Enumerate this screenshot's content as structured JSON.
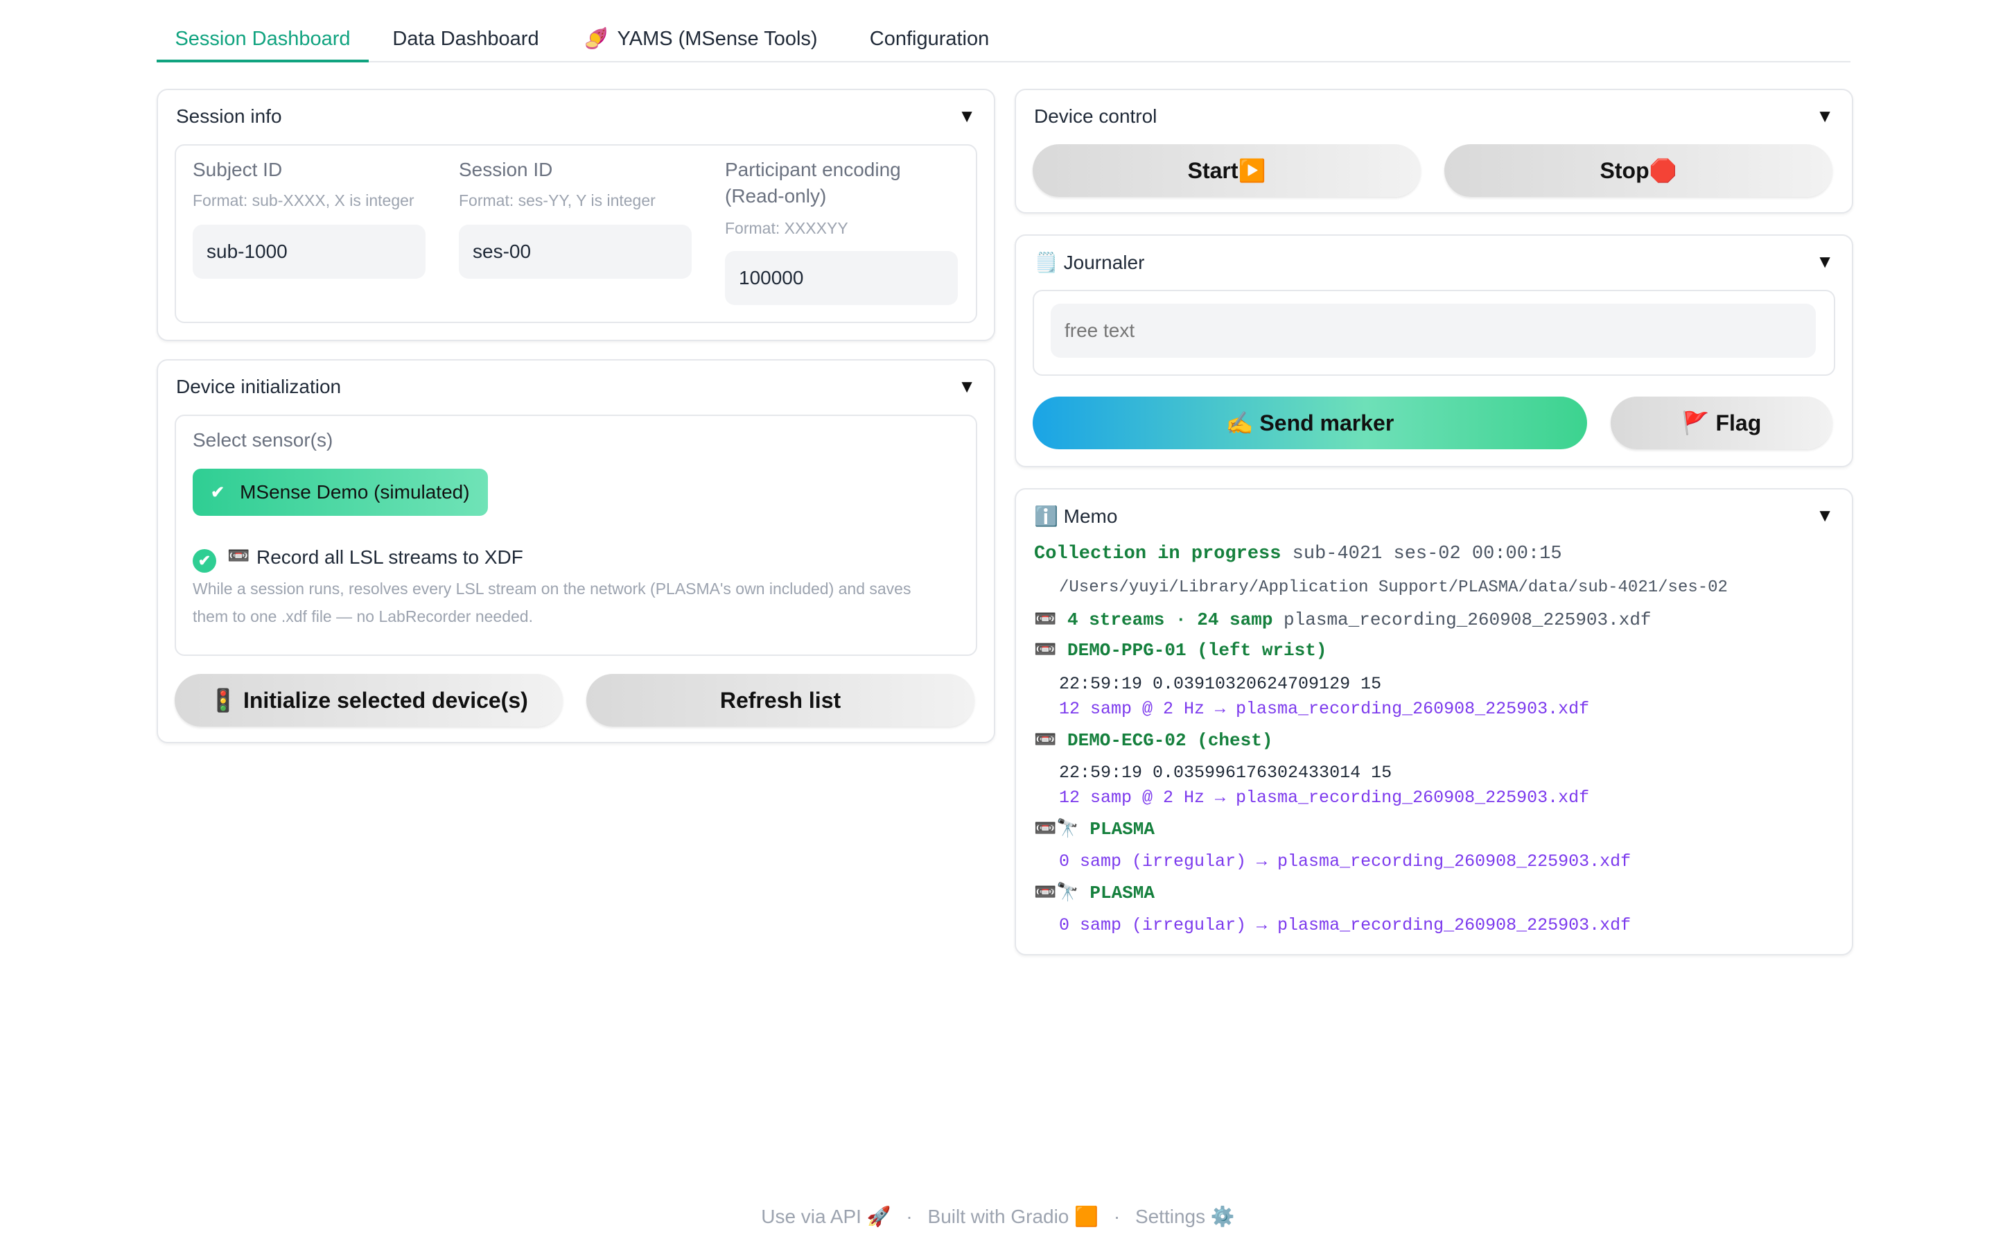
{
  "tabs": [
    {
      "label": "Session Dashboard",
      "icon": ""
    },
    {
      "label": "Data Dashboard",
      "icon": ""
    },
    {
      "label": "YAMS (MSense Tools)",
      "icon": "🍠"
    },
    {
      "label": "Configuration",
      "icon": ""
    }
  ],
  "session_info": {
    "title": "Session info",
    "toggle": "▼",
    "subject": {
      "label": "Subject ID",
      "hint": "Format: sub-XXXX, X is integer",
      "value": "sub-1000"
    },
    "session": {
      "label": "Session ID",
      "hint": "Format: ses-YY, Y is integer",
      "value": "ses-00"
    },
    "encoding": {
      "label_line1": "Participant encoding",
      "label_line2": "(Read-only)",
      "hint": "Format: XXXXYY",
      "value": "100000"
    }
  },
  "device_init": {
    "title": "Device initialization",
    "toggle": "▼",
    "select_label": "Select sensor(s)",
    "sensor_chip": "MSense Demo (simulated)",
    "check_glyph": "✔",
    "record_icon": "📼",
    "record_label": "Record all LSL streams to XDF",
    "record_hint_line1": "While a session runs, resolves every LSL stream on the network (PLASMA's own included) and saves",
    "record_hint_line2": "them to one .xdf file — no LabRecorder needed.",
    "init_button": "🚦 Initialize selected device(s)",
    "refresh_button": "Refresh list"
  },
  "device_control": {
    "title": "Device control",
    "toggle": "▼",
    "start_button": "Start▶️",
    "stop_button": "Stop🛑"
  },
  "journaler": {
    "title_icon": "🗒️",
    "title": "Journaler",
    "toggle": "▼",
    "placeholder": "free text",
    "send_button": "✍️ Send marker",
    "flag_button": "🚩 Flag"
  },
  "memo": {
    "title_icon": "ℹ️",
    "title": "Memo",
    "toggle": "▼",
    "status_bold": "Collection in progress",
    "status_rest": "sub-4021 ses-02 00:00:15",
    "path": "/Users/yuyi/Library/Application Support/PLASMA/data/sub-4021/ses-02",
    "summary_icon": "📼",
    "summary_bold": "4 streams · 24 samp",
    "summary_file": "plasma_recording_260908_225903.xdf",
    "streams": [
      {
        "icon": "📼",
        "name": "DEMO-PPG-01 (left wrist)",
        "value": "22:59:19 0.03910320624709129 15",
        "rate": "12 samp @ 2 Hz → plasma_recording_260908_225903.xdf"
      },
      {
        "icon": "📼",
        "name": "DEMO-ECG-02 (chest)",
        "value": "22:59:19 0.035996176302433014 15",
        "rate": "12 samp @ 2 Hz → plasma_recording_260908_225903.xdf"
      },
      {
        "icon": "📼🔭",
        "name": "PLASMA",
        "value": "",
        "rate": "0 samp (irregular) → plasma_recording_260908_225903.xdf"
      },
      {
        "icon": "📼🔭",
        "name": "PLASMA",
        "value": "",
        "rate": "0 samp (irregular) → plasma_recording_260908_225903.xdf"
      }
    ]
  },
  "footer": {
    "api": "Use via API",
    "api_icon": "🚀",
    "sep": "·",
    "built": "Built with Gradio",
    "built_icon": "🟧",
    "settings": "Settings",
    "settings_icon": "⚙️"
  },
  "colors": {
    "accent": "#10a37f",
    "memo_green": "#15803d",
    "memo_purple": "#7c3aed"
  }
}
